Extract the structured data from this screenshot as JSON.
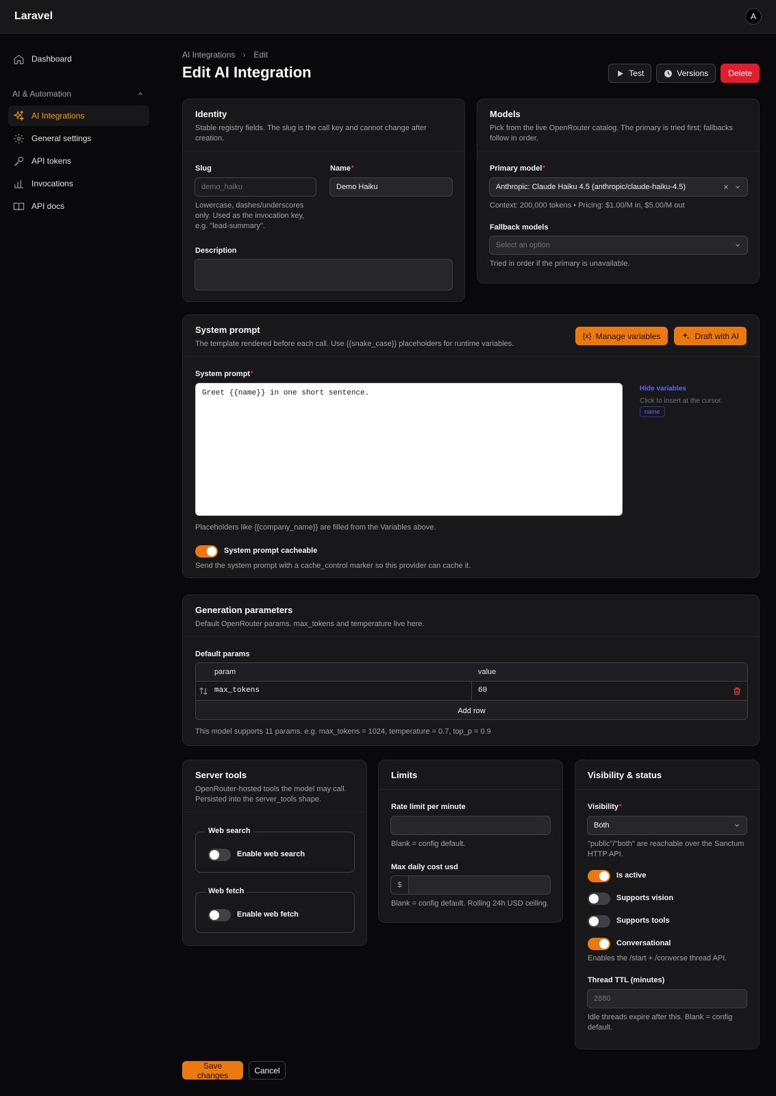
{
  "app": {
    "brand": "Laravel",
    "avatar": "A"
  },
  "sidebar": {
    "items": [
      {
        "label": "Dashboard"
      },
      {
        "label": "AI Integrations"
      },
      {
        "label": "General settings"
      },
      {
        "label": "API tokens"
      },
      {
        "label": "Invocations"
      },
      {
        "label": "API docs"
      }
    ],
    "group_label": "AI & Automation"
  },
  "breadcrumb": {
    "parent": "AI Integrations",
    "current": "Edit"
  },
  "page_title": "Edit AI Integration",
  "header_actions": {
    "test": "Test",
    "versions": "Versions",
    "delete": "Delete"
  },
  "identity": {
    "title": "Identity",
    "desc": "Stable registry fields. The slug is the call key and cannot change after creation.",
    "slug_label": "Slug",
    "slug_value": "demo_haiku",
    "slug_help": "Lowercase, dashes/underscores only. Used as the invocation key, e.g. \"lead-summary\".",
    "name_label": "Name",
    "name_value": "Demo Haiku",
    "description_label": "Description"
  },
  "models": {
    "title": "Models",
    "desc": "Pick from the live OpenRouter catalog. The primary is tried first; fallbacks follow in order.",
    "primary_label": "Primary model",
    "primary_value": "Anthropic: Claude Haiku 4.5 (anthropic/claude-haiku-4.5)",
    "primary_help": "Context: 200,000 tokens • Pricing: $1.00/M in, $5.00/M out",
    "fallback_label": "Fallback models",
    "fallback_placeholder": "Select an option",
    "fallback_help": "Tried in order if the primary is unavailable."
  },
  "system_prompt": {
    "title": "System prompt",
    "desc": "The template rendered before each call. Use {{snake_case}} placeholders for runtime variables.",
    "manage_variables": "Manage variables",
    "draft_with_ai": "Draft with AI",
    "field_label": "System prompt",
    "value": "Greet {{name}} in one short sentence.",
    "hide_variables": "Hide variables",
    "insert_help": "Click to insert at the cursor.",
    "variable_chip": "name",
    "placeholder_help": "Placeholders like {{company_name}} are filled from the Variables above.",
    "cacheable_label": "System prompt cacheable",
    "cacheable_on": true,
    "cacheable_help": "Send the system prompt with a cache_control marker so this provider can cache it."
  },
  "generation": {
    "title": "Generation parameters",
    "desc": "Default OpenRouter params. max_tokens and temperature live here.",
    "params_label": "Default params",
    "col_param": "param",
    "col_value": "value",
    "rows": [
      {
        "param": "max_tokens",
        "value": "60"
      }
    ],
    "add_row": "Add row",
    "help": "This model supports 11 params. e.g. max_tokens = 1024, temperature = 0.7, top_p = 0.9"
  },
  "server_tools": {
    "title": "Server tools",
    "desc": "OpenRouter-hosted tools the model may call. Persisted into the server_tools shape.",
    "web_search_legend": "Web search",
    "web_search_label": "Enable web search",
    "web_fetch_legend": "Web fetch",
    "web_fetch_label": "Enable web fetch"
  },
  "limits": {
    "title": "Limits",
    "rate_label": "Rate limit per minute",
    "rate_help": "Blank = config default.",
    "cost_label": "Max daily cost usd",
    "cost_prefix": "$",
    "cost_help": "Blank = config default. Rolling 24h USD ceiling."
  },
  "visibility": {
    "title": "Visibility & status",
    "visibility_label": "Visibility",
    "visibility_value": "Both",
    "visibility_help": "\"public\"/\"both\" are reachable over the Sanctum HTTP API.",
    "is_active": "Is active",
    "supports_vision": "Supports vision",
    "supports_tools": "Supports tools",
    "conversational": "Conversational",
    "conversational_help": "Enables the /start + /converse thread API.",
    "ttl_label": "Thread TTL (minutes)",
    "ttl_placeholder": "2880",
    "ttl_help": "Idle threads expire after this. Blank = config default."
  },
  "footer": {
    "save": "Save changes",
    "cancel": "Cancel"
  },
  "colors": {
    "accent": "#ea7a10",
    "danger": "#e11d2e",
    "active_nav": "#f59e0b",
    "link": "#6366f1"
  }
}
